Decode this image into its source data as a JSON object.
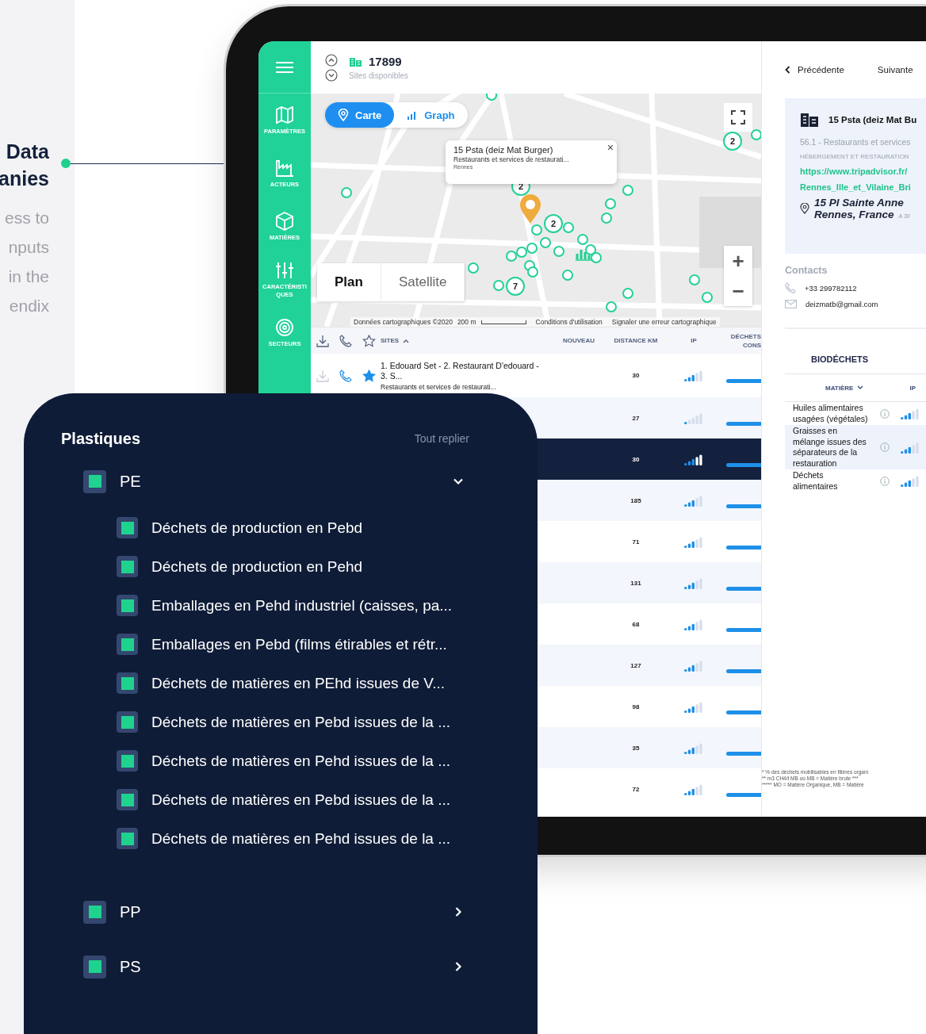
{
  "intro": {
    "title_lines": [
      "Data",
      "anies"
    ],
    "text_lines": [
      "ess to",
      "nputs",
      "in the",
      "endix"
    ]
  },
  "sidebar": {
    "items": [
      {
        "kind": "map",
        "label": "PARAMÈTRES"
      },
      {
        "kind": "factory",
        "label": "ACTEURS"
      },
      {
        "kind": "cube",
        "label": "MATIÈRES"
      },
      {
        "kind": "sliders",
        "label": "CARACTÉRISTIQUES"
      },
      {
        "kind": "target",
        "label": "SECTEURS"
      }
    ]
  },
  "header": {
    "count": "17899",
    "subtitle": "Sites disponibles"
  },
  "map": {
    "view_toggle": [
      {
        "kind": "pin",
        "label": "Carte",
        "selected": true
      },
      {
        "kind": "bars",
        "label": "Graph",
        "selected": false
      }
    ],
    "popup": {
      "title": "15 Psta (deiz Mat Burger)",
      "category": "Restaurants et services de restaurati...",
      "city": "Rennes",
      "close": "×"
    },
    "clusters": [
      {
        "count": "2"
      },
      {
        "count": "2"
      },
      {
        "count": "2"
      },
      {
        "count": "7"
      }
    ],
    "map_types": [
      {
        "label": "Plan",
        "selected": true
      },
      {
        "label": "Satellite",
        "selected": false
      }
    ],
    "zoom_in": "+",
    "zoom_out": "−",
    "attribution": {
      "data": "Données cartographiques ©2020",
      "scale": "200 m",
      "terms": "Conditions d'utilisation",
      "report": "Signaler une erreur cartographique"
    }
  },
  "table": {
    "columns": [
      "SITES",
      "NOUVEAU",
      "DISTANCE KM",
      "IP"
    ],
    "column_5_lines": [
      "DÉCHETS",
      "CONS"
    ],
    "rows": [
      {
        "site": "1. Edouard Set - 2. Restaurant D'edouard - 3. S...",
        "category": "Restaurants et services de restaurati...",
        "favorite": true,
        "distance": "30",
        "ip": {
          "level": 0.6
        },
        "selected": false
      },
      {
        "distance": "27",
        "ip": {
          "level": 0.2
        },
        "selected": false
      },
      {
        "distance": "30",
        "ip": {
          "level": 0.6
        },
        "selected": true
      },
      {
        "distance": "185",
        "ip": {
          "level": 0.6
        },
        "selected": false
      },
      {
        "distance": "71",
        "ip": {
          "level": 0.6
        },
        "selected": false
      },
      {
        "distance": "131",
        "ip": {
          "level": 0.6
        },
        "selected": false
      },
      {
        "distance": "68",
        "ip": {
          "level": 0.6
        },
        "selected": false
      },
      {
        "distance": "127",
        "ip": {
          "level": 0.6
        },
        "selected": false
      },
      {
        "distance": "98",
        "ip": {
          "level": 0.6
        },
        "selected": false
      },
      {
        "distance": "35",
        "ip": {
          "level": 0.6
        },
        "selected": false
      },
      {
        "distance": "72",
        "ip": {
          "level": 0.6
        },
        "selected": false
      }
    ]
  },
  "detail": {
    "previous": "Précédente",
    "next": "Suivante",
    "name": "15 Psta (deiz Mat Bu",
    "code": "56.1 - Restaurants et services",
    "sector": "HÉBERGEMENT ET RESTAURATION",
    "url_lines": [
      "https://www.tripadvisor.fr/",
      "Rennes_Ille_et_Vilaine_Bri"
    ],
    "address_lines": [
      "15 Pl Sainte Anne",
      "Rennes, France"
    ],
    "distance": "A 30",
    "contacts_title": "Contacts",
    "phone": "+33 299782112",
    "email": "deizmatb@gmail.com",
    "section": "BIODÉCHETS",
    "columns": [
      "MATIÈRE",
      "IP"
    ],
    "rows": [
      {
        "name": "Huiles alimentaires usagées (végétales)",
        "ip": {
          "level": 0.6
        },
        "selected": false
      },
      {
        "name": "Graisses en mélange issues des séparateurs de la restauration",
        "ip": {
          "level": 0.6
        },
        "selected": true
      },
      {
        "name": "Déchets alimentaires",
        "ip": {
          "level": 0.6
        },
        "selected": false
      }
    ],
    "footnotes": [
      "* % des déchets mobilisables en filières organi",
      "** m3 CH4/t MB où MB = Matière brute   ***",
      "***** MO = Matière Organique, MB = Matière"
    ]
  },
  "filter_panel": {
    "title": "Plastiques",
    "collapse_all": "Tout replier",
    "groups": [
      {
        "label": "PE",
        "checked": true,
        "expanded": true,
        "children": [
          {
            "label": "Déchets de production en Pebd",
            "checked": true
          },
          {
            "label": "Déchets de production en Pehd",
            "checked": true
          },
          {
            "label": "Emballages en Pehd industriel (caisses, pa...",
            "checked": true
          },
          {
            "label": "Emballages en Pebd (films étirables et rétr...",
            "checked": true
          },
          {
            "label": "Déchets de matières en PEhd issues de V...",
            "checked": true
          },
          {
            "label": "Déchets de matières en Pebd issues de la ...",
            "checked": true
          },
          {
            "label": "Déchets de matières en Pehd issues de la ...",
            "checked": true
          },
          {
            "label": "Déchets de matières en Pebd issues de la ...",
            "checked": true
          },
          {
            "label": "Déchets de matières en Pehd issues de la ...",
            "checked": true
          }
        ]
      },
      {
        "label": "PP",
        "checked": true,
        "expanded": false
      },
      {
        "label": "PS",
        "checked": true,
        "expanded": false
      }
    ]
  }
}
